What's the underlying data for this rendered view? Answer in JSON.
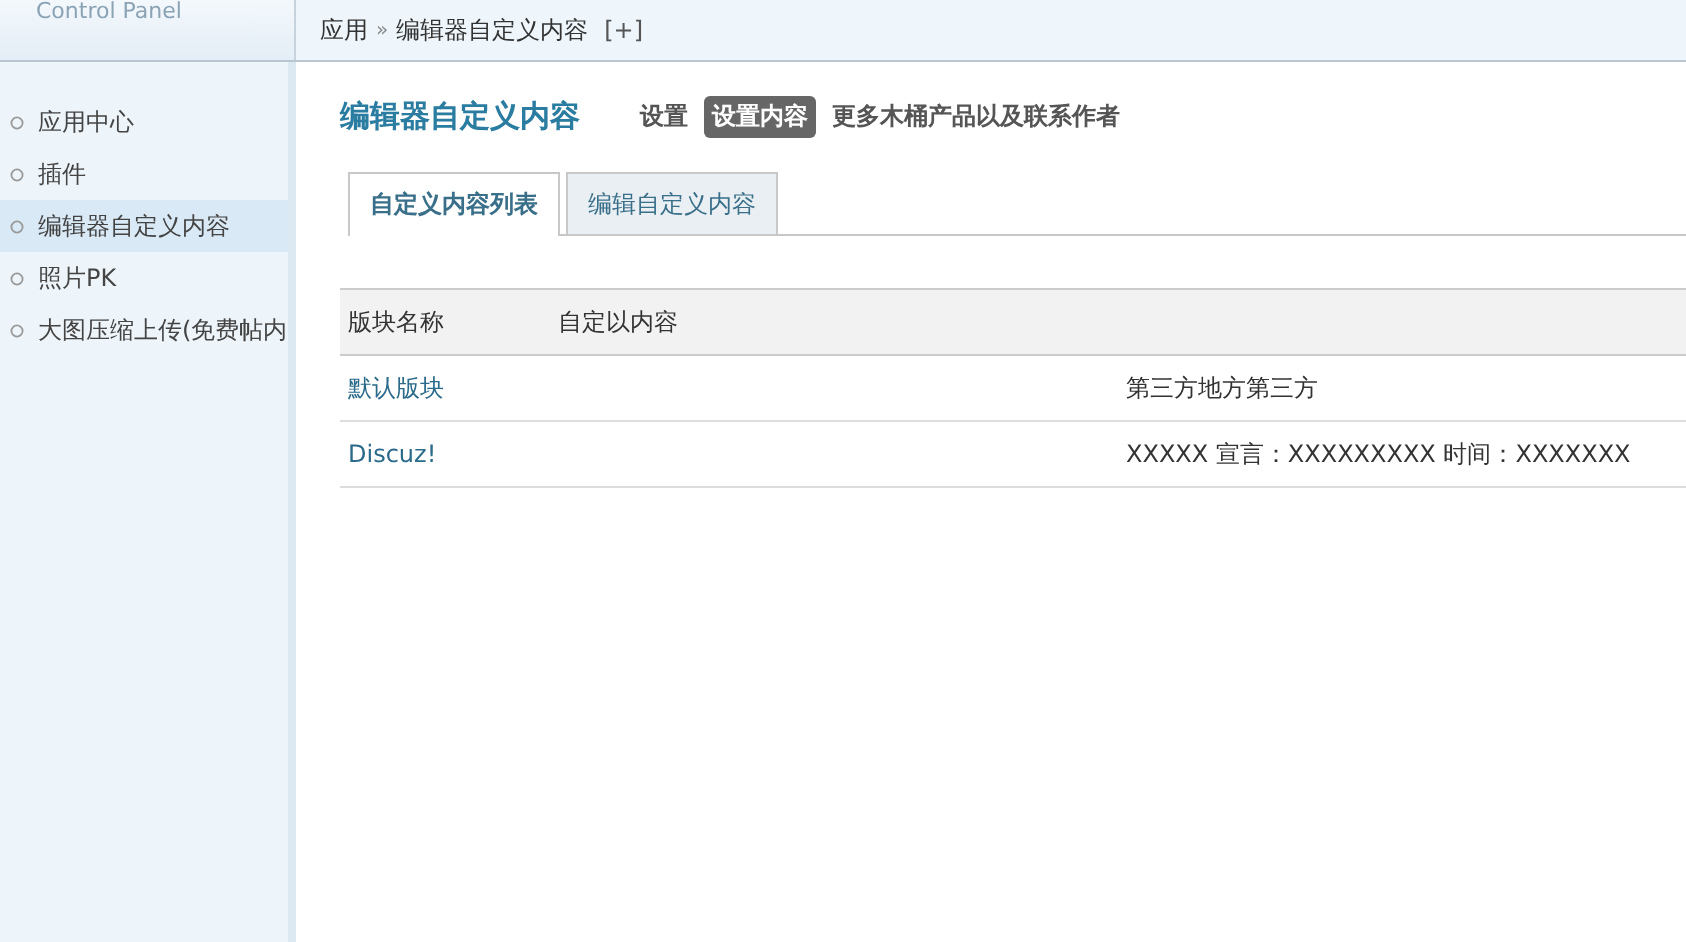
{
  "logo": {
    "text": "Control Panel"
  },
  "breadcrumb": {
    "items": [
      "应用",
      "编辑器自定义内容"
    ],
    "separator": "»",
    "add": "[+]"
  },
  "sidebar": {
    "items": [
      {
        "label": "应用中心",
        "selected": false
      },
      {
        "label": "插件",
        "selected": false
      },
      {
        "label": "编辑器自定义内容",
        "selected": true
      },
      {
        "label": "照片PK",
        "selected": false
      },
      {
        "label": "大图压缩上传(免费帖内",
        "selected": false
      }
    ]
  },
  "page": {
    "title": "编辑器自定义内容",
    "links": [
      {
        "label": "设置",
        "selected": false
      },
      {
        "label": "设置内容",
        "selected": true
      },
      {
        "label": "更多木桶产品以及联系作者",
        "selected": false
      }
    ]
  },
  "tabs": [
    {
      "label": "自定义内容列表",
      "selected": true
    },
    {
      "label": "编辑自定义内容",
      "selected": false
    }
  ],
  "table": {
    "columns": [
      "版块名称",
      "自定以内容"
    ],
    "rows": [
      {
        "name": "默认版块",
        "content": "第三方地方第三方"
      },
      {
        "name": "Discuz!",
        "content": "XXXXX 宣言：XXXXXXXXX 时间：XXXXXXX"
      }
    ]
  }
}
